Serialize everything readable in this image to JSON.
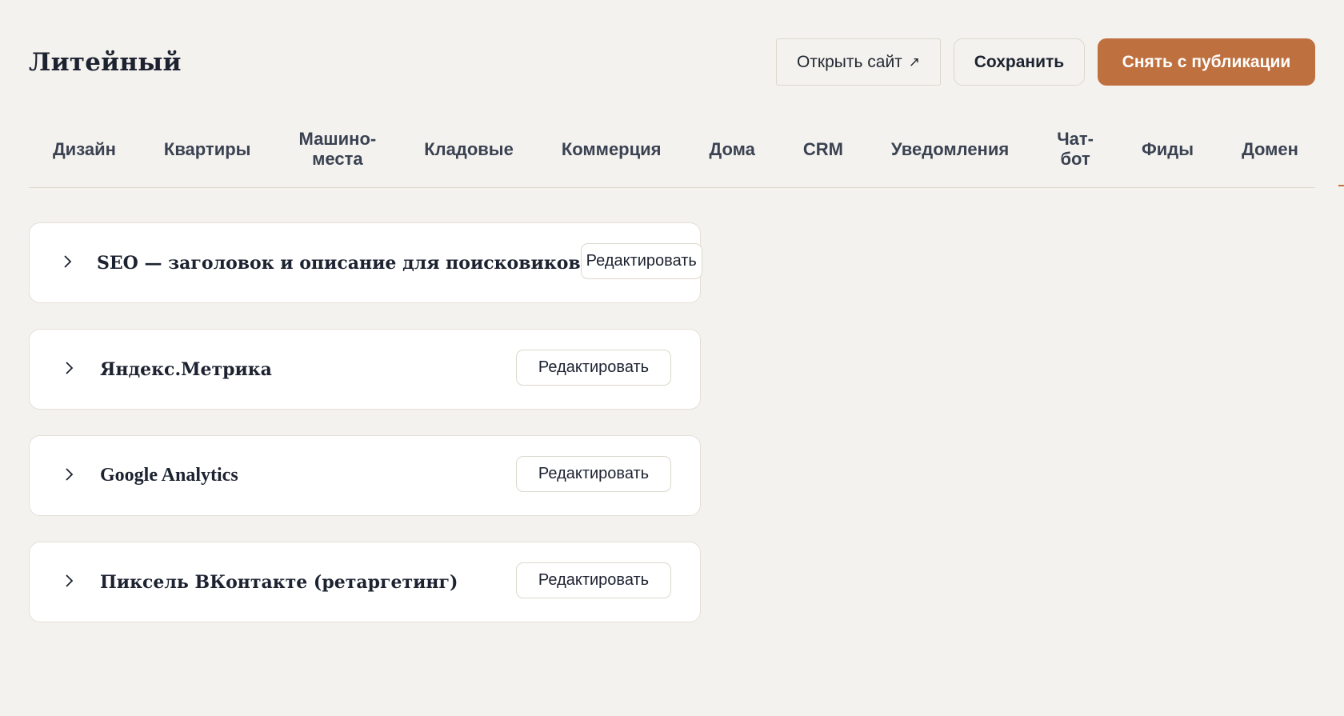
{
  "header": {
    "title": "Литейный",
    "open_site_label": "Открыть сайт",
    "open_site_icon": "external-link-icon",
    "save_label": "Сохранить",
    "unpublish_label": "Снять с публикации"
  },
  "colors": {
    "background": "#f4f2ee",
    "accent": "#bf703f",
    "card_background": "#ffffff",
    "border": "#dcd8cc",
    "text": "#1c2230"
  },
  "tabs": [
    {
      "line1": "Дизайн",
      "line2": ""
    },
    {
      "line1": "Квартиры",
      "line2": ""
    },
    {
      "line1": "Машино-",
      "line2": "места"
    },
    {
      "line1": "Кладовые",
      "line2": ""
    },
    {
      "line1": "Коммерция",
      "line2": ""
    },
    {
      "line1": "Дома",
      "line2": ""
    },
    {
      "line1": "CRM",
      "line2": ""
    },
    {
      "line1": "Уведомления",
      "line2": ""
    },
    {
      "line1": "Чат-",
      "line2": "бот"
    },
    {
      "line1": "Фиды",
      "line2": ""
    },
    {
      "line1": "Домен",
      "line2": ""
    }
  ],
  "cards": [
    {
      "title": "SEO — заголовок и описание для поисковиков",
      "edit_label": "Редактировать",
      "icon": "chevron-right-icon"
    },
    {
      "title": "Яндекс.Метрика",
      "edit_label": "Редактировать",
      "icon": "chevron-right-icon"
    },
    {
      "title": "Google Analytics",
      "edit_label": "Редактировать",
      "icon": "chevron-right-icon"
    },
    {
      "title": "Пиксель ВКонтакте (ретаргетинг)",
      "edit_label": "Редактировать",
      "icon": "chevron-right-icon"
    }
  ]
}
